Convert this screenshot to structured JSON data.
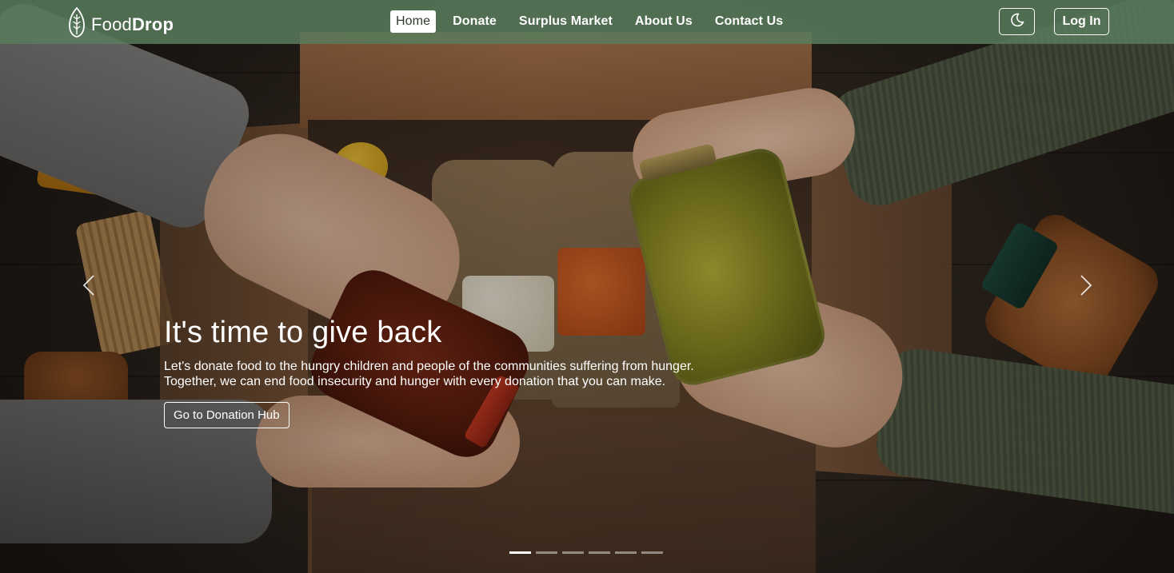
{
  "navbar": {
    "brand": {
      "name_light": "Food",
      "name_bold": "Drop",
      "icon": "wheat-leaf-icon"
    },
    "links": [
      {
        "label": "Home",
        "active": true
      },
      {
        "label": "Donate",
        "active": false
      },
      {
        "label": "Surplus Market",
        "active": false
      },
      {
        "label": "About Us",
        "active": false
      },
      {
        "label": "Contact Us",
        "active": false
      }
    ],
    "theme_toggle_icon": "moon-icon",
    "login_label": "Log In",
    "background_color": "#587c5c"
  },
  "hero": {
    "title": "It's time to give back",
    "description_line1": "Let's donate food to the hungry children and people of the communities suffering from hunger.",
    "description_line2": "Together, we can end food insecurity and hunger with every donation that you can make.",
    "cta_label": "Go to Donation Hub"
  },
  "carousel": {
    "prev_icon": "chevron-left-icon",
    "next_icon": "chevron-right-icon",
    "slide_count": 6,
    "active_index": 0
  }
}
